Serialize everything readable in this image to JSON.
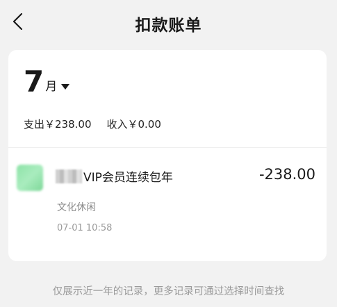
{
  "header": {
    "title": "扣款账单",
    "back_icon": "back-chevron-icon"
  },
  "month_selector": {
    "month_number": "7",
    "month_unit": "月",
    "dropdown_icon": "caret-down-icon"
  },
  "summary": {
    "expense": "支出￥238.00",
    "income": "收入￥0.00"
  },
  "bills": [
    {
      "name": "VIP会员连续包年",
      "category": "文化休闲",
      "time": "07-01 10:58",
      "amount": "-238.00",
      "icon": "merchant-logo-icon"
    }
  ],
  "footnote": "仅展示近一年的记录，更多记录可通过选择时间查找"
}
